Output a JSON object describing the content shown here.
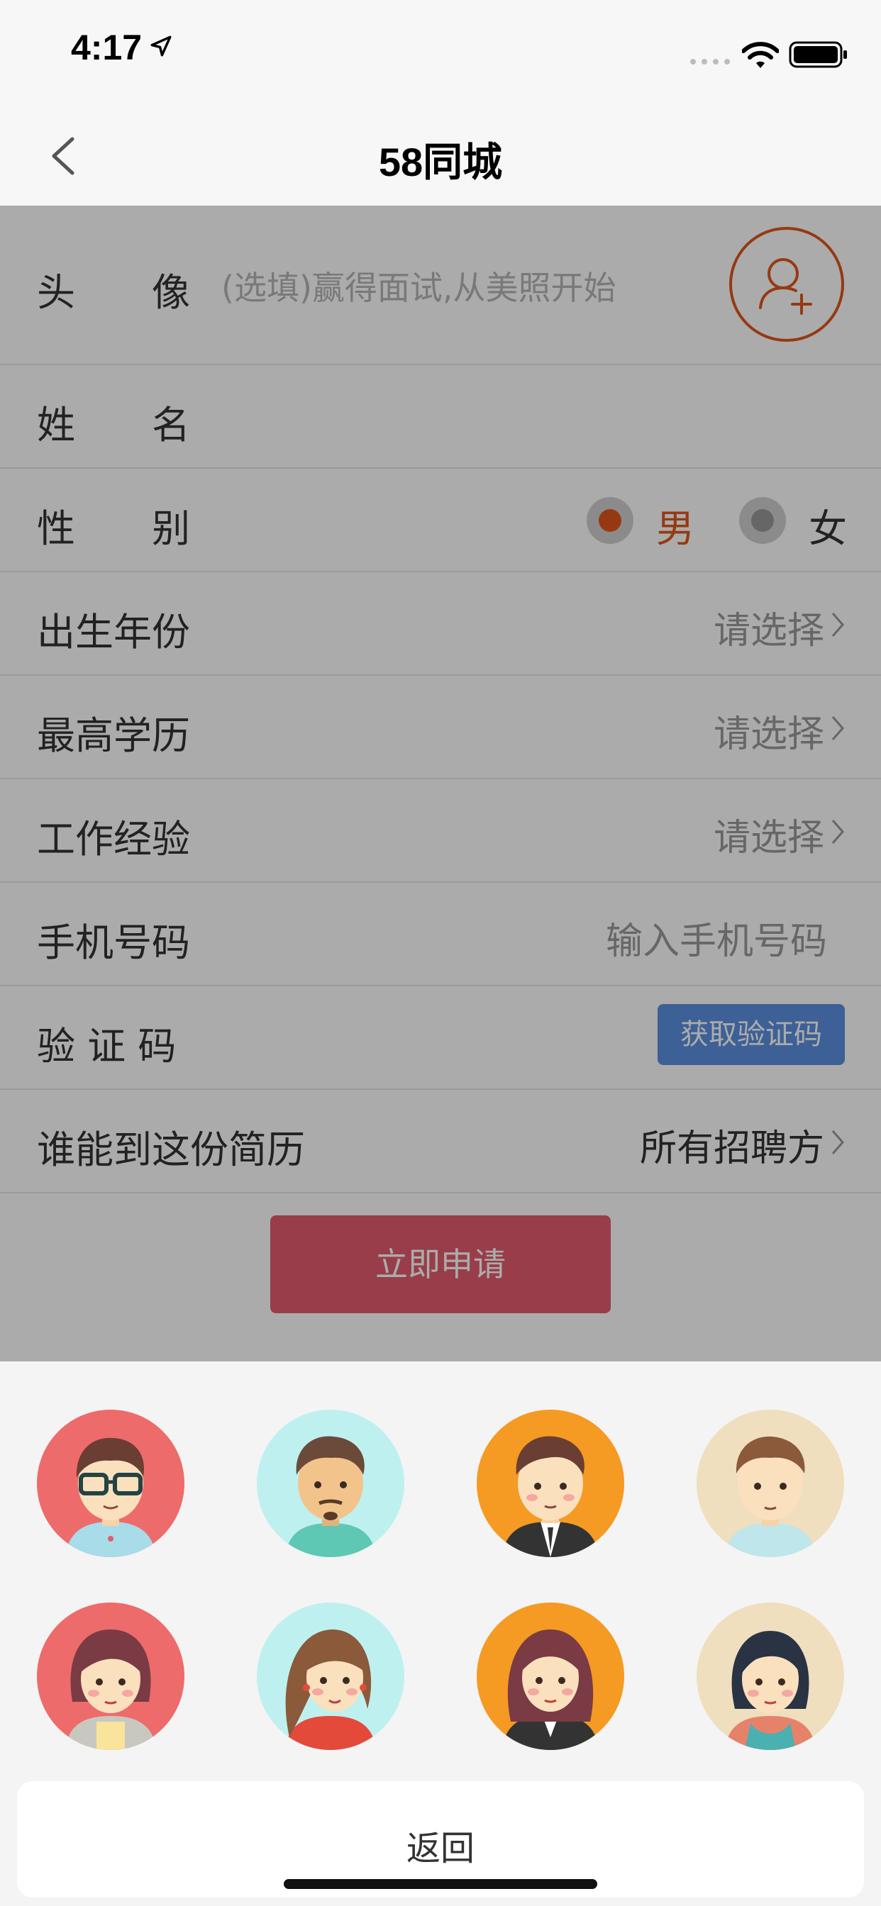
{
  "status_bar": {
    "time": "4:17"
  },
  "nav": {
    "title": "58同城"
  },
  "form": {
    "avatar": {
      "label": "头　　像",
      "hint": "(选填)赢得面试,从美照开始"
    },
    "name": {
      "label": "姓　　名"
    },
    "gender": {
      "label": "性　　别",
      "male": "男",
      "female": "女",
      "selected": "male"
    },
    "birth_year": {
      "label": "出生年份",
      "value": "请选择"
    },
    "education": {
      "label": "最高学历",
      "value": "请选择"
    },
    "experience": {
      "label": "工作经验",
      "value": "请选择"
    },
    "phone": {
      "label": "手机号码",
      "placeholder": "输入手机号码"
    },
    "code": {
      "label": "验 证 码",
      "button": "获取验证码"
    },
    "visibility": {
      "label": "谁能到这份简历",
      "value": "所有招聘方"
    },
    "apply_button": "立即申请"
  },
  "colors": {
    "accent": "#e0561c",
    "code_button": "#5b8fe0",
    "apply_button": "#e35b6d",
    "avatar_backgrounds": [
      "#ee6b6b",
      "#bff0f0",
      "#f59a23",
      "#efdfbf"
    ]
  },
  "sheet": {
    "avatars": [
      {
        "name": "male-glasses-avatar",
        "gender": "male"
      },
      {
        "name": "male-beard-avatar",
        "gender": "male"
      },
      {
        "name": "male-suit-avatar",
        "gender": "male"
      },
      {
        "name": "male-casual-avatar",
        "gender": "male"
      },
      {
        "name": "female-bob-avatar",
        "gender": "female"
      },
      {
        "name": "female-long-hair-avatar",
        "gender": "female"
      },
      {
        "name": "female-suit-avatar",
        "gender": "female"
      },
      {
        "name": "female-casual-avatar",
        "gender": "female"
      }
    ],
    "return_label": "返回"
  }
}
